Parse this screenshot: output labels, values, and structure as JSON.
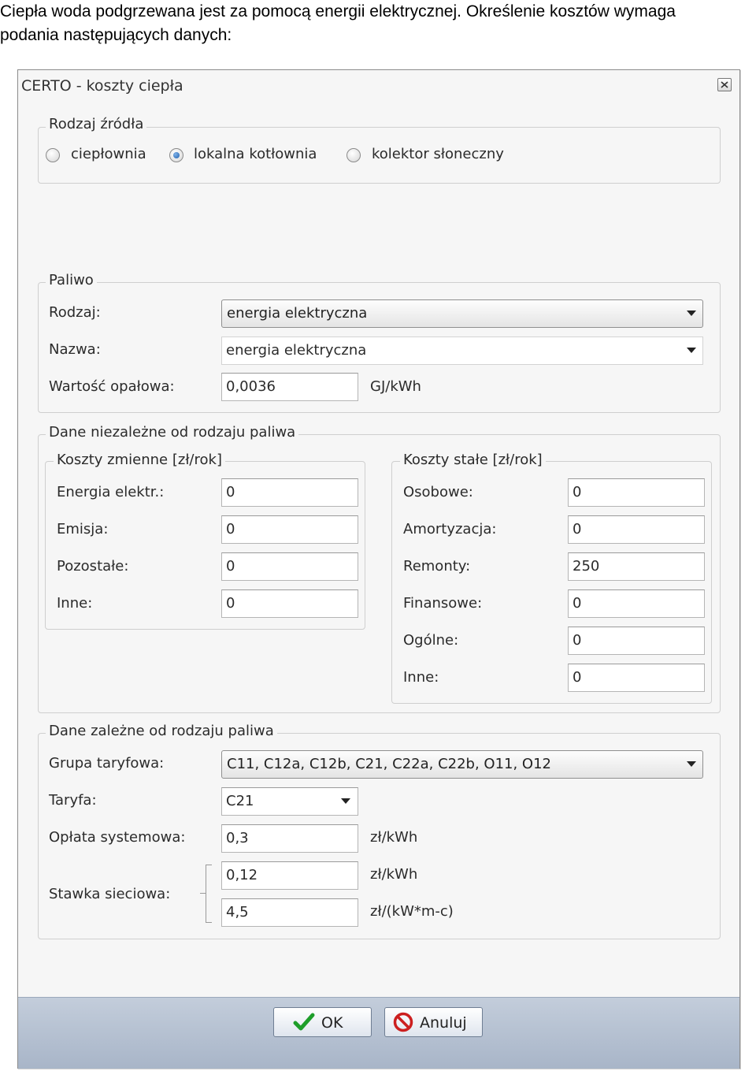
{
  "intro": {
    "line1": "Ciepła woda podgrzewana jest za pomocą energii elektrycznej.  Określenie kosztów wymaga",
    "line2": "podania następujących danych:"
  },
  "window": {
    "title": "CERTO - koszty ciepła"
  },
  "source": {
    "legend": "Rodzaj źródła",
    "options": [
      {
        "label": "ciepłownia",
        "checked": false
      },
      {
        "label": "lokalna kotłownia",
        "checked": true
      },
      {
        "label": "kolektor słoneczny",
        "checked": false
      }
    ]
  },
  "fuel": {
    "legend": "Paliwo",
    "type_label": "Rodzaj:",
    "type_value": "energia elektryczna",
    "name_label": "Nazwa:",
    "name_value": "energia elektryczna",
    "calorific_label": "Wartość opałowa:",
    "calorific_value": "0,0036",
    "calorific_unit": "GJ/kWh"
  },
  "independent": {
    "legend": "Dane niezależne od rodzaju paliwa",
    "variable": {
      "legend": "Koszty zmienne [zł/rok]",
      "rows": [
        {
          "label": "Energia elektr.:",
          "value": "0"
        },
        {
          "label": "Emisja:",
          "value": "0"
        },
        {
          "label": "Pozostałe:",
          "value": "0"
        },
        {
          "label": "Inne:",
          "value": "0"
        }
      ]
    },
    "fixed": {
      "legend": "Koszty stałe [zł/rok]",
      "rows": [
        {
          "label": "Osobowe:",
          "value": "0"
        },
        {
          "label": "Amortyzacja:",
          "value": "0"
        },
        {
          "label": "Remonty:",
          "value": "250"
        },
        {
          "label": "Finansowe:",
          "value": "0"
        },
        {
          "label": "Ogólne:",
          "value": "0"
        },
        {
          "label": "Inne:",
          "value": "0"
        }
      ]
    }
  },
  "dependent": {
    "legend": "Dane zależne od rodzaju paliwa",
    "tariff_group_label": "Grupa taryfowa:",
    "tariff_group_value": "C11, C12a, C12b, C21, C22a, C22b, O11, O12",
    "tariff_label": "Taryfa:",
    "tariff_value": "C21",
    "system_fee_label": "Opłata systemowa:",
    "system_fee_value": "0,3",
    "system_fee_unit": "zł/kWh",
    "network_rate_label": "Stawka sieciowa:",
    "network_rate_value1": "0,12",
    "network_rate_unit1": "zł/kWh",
    "network_rate_value2": "4,5",
    "network_rate_unit2": "zł/(kW*m-c)"
  },
  "buttons": {
    "ok": "OK",
    "cancel": "Anuluj"
  },
  "colors": {
    "ok_check": "#1e9e2a",
    "cancel_icon": "#cc1f1f",
    "radio_selected": "#1f5fae"
  }
}
